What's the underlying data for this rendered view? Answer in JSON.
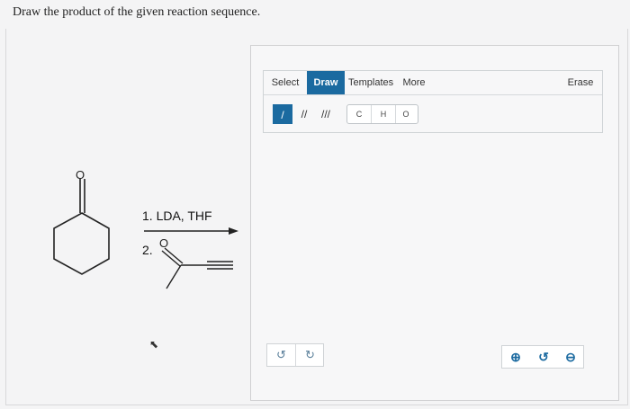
{
  "question": "Draw the product of the given reaction sequence.",
  "reaction": {
    "step1": "1. LDA, THF",
    "step2": "2.",
    "reagent_oxygen": "O",
    "reactant_oxygen": "O"
  },
  "editor": {
    "tabs": [
      {
        "label": "Select",
        "active": false
      },
      {
        "label": "Draw",
        "active": true
      },
      {
        "label": "Templates",
        "active": false
      },
      {
        "label": "More",
        "active": false
      }
    ],
    "erase_label": "Erase",
    "bond_tools": [
      {
        "icon": "single-bond-icon",
        "glyph": "/",
        "selected": true
      },
      {
        "icon": "double-bond-icon",
        "glyph": "//",
        "selected": false
      },
      {
        "icon": "triple-bond-icon",
        "glyph": "///",
        "selected": false
      }
    ],
    "atoms": [
      "C",
      "H",
      "O"
    ],
    "undo_icon": "undo-icon",
    "redo_icon": "redo-icon",
    "zoom_in_icon": "zoom-in-icon",
    "zoom_reset_icon": "zoom-reset-icon",
    "zoom_out_icon": "zoom-out-icon"
  },
  "colors": {
    "accent": "#1b6aa0",
    "background": "#f4f4f5"
  }
}
